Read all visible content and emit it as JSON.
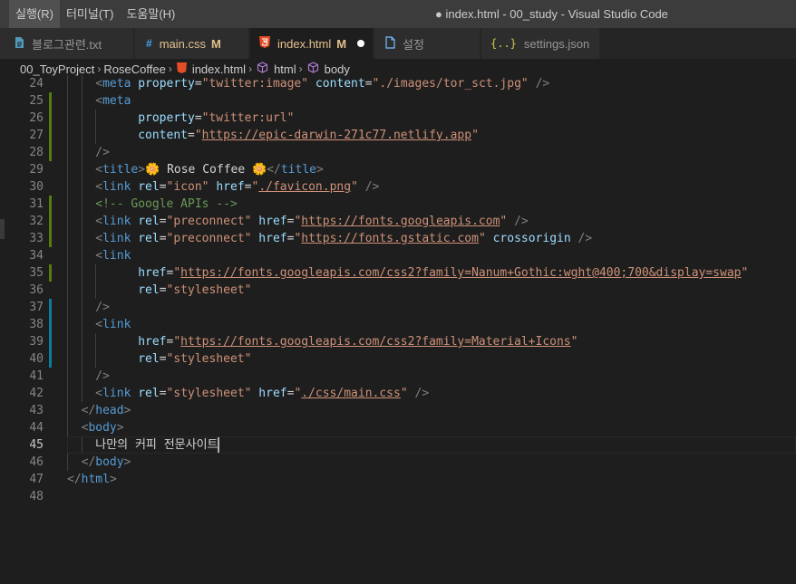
{
  "menu": [
    "실행(R)",
    "터미널(T)",
    "도움말(H)"
  ],
  "window_title": "● index.html - 00_study - Visual Studio Code",
  "tabs": [
    {
      "label": "블로그관련.txt",
      "icon": "file-icon",
      "modified": ""
    },
    {
      "label": "main.css",
      "icon": "css-icon",
      "modified": "M"
    },
    {
      "label": "index.html",
      "icon": "html5-icon",
      "modified": "M"
    },
    {
      "label": "설정",
      "icon": "file-icon",
      "modified": ""
    },
    {
      "label": "settings.json",
      "icon": "json-braces-icon",
      "modified": ""
    }
  ],
  "breadcrumb": [
    "00_ToyProject",
    "RoseCoffee",
    "index.html",
    "html",
    "body"
  ],
  "editor": {
    "current_line": "45",
    "lines": [
      {
        "n": "24",
        "tokens": [
          [
            "t-punc",
            "<"
          ],
          [
            "t-tag",
            "meta"
          ],
          [
            "t-txt",
            " "
          ],
          [
            "t-attr",
            "property"
          ],
          [
            "t-txt",
            "="
          ],
          [
            "t-str",
            "\"twitter:image\""
          ],
          [
            "t-txt",
            " "
          ],
          [
            "t-attr",
            "content"
          ],
          [
            "t-txt",
            "="
          ],
          [
            "t-str",
            "\"./images/tor_sct.jpg\""
          ],
          [
            "t-txt",
            " "
          ],
          [
            "t-punc",
            "/>"
          ]
        ]
      },
      {
        "n": "25",
        "tokens": [
          [
            "t-punc",
            "<"
          ],
          [
            "t-tag",
            "meta"
          ]
        ]
      },
      {
        "n": "26",
        "tokens": [
          [
            "t-txt",
            "  "
          ],
          [
            "t-attr",
            "property"
          ],
          [
            "t-txt",
            "="
          ],
          [
            "t-str",
            "\"twitter:url\""
          ]
        ]
      },
      {
        "n": "27",
        "tokens": [
          [
            "t-txt",
            "  "
          ],
          [
            "t-attr",
            "content"
          ],
          [
            "t-txt",
            "="
          ],
          [
            "t-str",
            "\""
          ],
          [
            "t-url",
            "https://epic-darwin-271c77.netlify.app"
          ],
          [
            "t-str",
            "\""
          ]
        ]
      },
      {
        "n": "28",
        "tokens": [
          [
            "t-punc",
            "/>"
          ]
        ]
      },
      {
        "n": "29",
        "tokens": [
          [
            "t-punc",
            "<"
          ],
          [
            "t-tag",
            "title"
          ],
          [
            "t-punc",
            ">"
          ],
          [
            "t-txt",
            "🌼 Rose Coffee 🌼"
          ],
          [
            "t-punc",
            "</"
          ],
          [
            "t-tag",
            "title"
          ],
          [
            "t-punc",
            ">"
          ]
        ]
      },
      {
        "n": "30",
        "tokens": [
          [
            "t-punc",
            "<"
          ],
          [
            "t-tag",
            "link"
          ],
          [
            "t-txt",
            " "
          ],
          [
            "t-attr",
            "rel"
          ],
          [
            "t-txt",
            "="
          ],
          [
            "t-str",
            "\"icon\""
          ],
          [
            "t-txt",
            " "
          ],
          [
            "t-attr",
            "href"
          ],
          [
            "t-txt",
            "="
          ],
          [
            "t-str",
            "\""
          ],
          [
            "t-url",
            "./favicon.png"
          ],
          [
            "t-str",
            "\""
          ],
          [
            "t-txt",
            " "
          ],
          [
            "t-punc",
            "/>"
          ]
        ]
      },
      {
        "n": "31",
        "tokens": [
          [
            "t-cmt",
            "<!-- Google APIs -->"
          ]
        ]
      },
      {
        "n": "32",
        "tokens": [
          [
            "t-punc",
            "<"
          ],
          [
            "t-tag",
            "link"
          ],
          [
            "t-txt",
            " "
          ],
          [
            "t-attr",
            "rel"
          ],
          [
            "t-txt",
            "="
          ],
          [
            "t-str",
            "\"preconnect\""
          ],
          [
            "t-txt",
            " "
          ],
          [
            "t-attr",
            "href"
          ],
          [
            "t-txt",
            "="
          ],
          [
            "t-str",
            "\""
          ],
          [
            "t-url",
            "https://fonts.googleapis.com"
          ],
          [
            "t-str",
            "\""
          ],
          [
            "t-txt",
            " "
          ],
          [
            "t-punc",
            "/>"
          ]
        ]
      },
      {
        "n": "33",
        "tokens": [
          [
            "t-punc",
            "<"
          ],
          [
            "t-tag",
            "link"
          ],
          [
            "t-txt",
            " "
          ],
          [
            "t-attr",
            "rel"
          ],
          [
            "t-txt",
            "="
          ],
          [
            "t-str",
            "\"preconnect\""
          ],
          [
            "t-txt",
            " "
          ],
          [
            "t-attr",
            "href"
          ],
          [
            "t-txt",
            "="
          ],
          [
            "t-str",
            "\""
          ],
          [
            "t-url",
            "https://fonts.gstatic.com"
          ],
          [
            "t-str",
            "\""
          ],
          [
            "t-txt",
            " "
          ],
          [
            "t-attr",
            "crossorigin"
          ],
          [
            "t-txt",
            " "
          ],
          [
            "t-punc",
            "/>"
          ]
        ]
      },
      {
        "n": "34",
        "tokens": [
          [
            "t-punc",
            "<"
          ],
          [
            "t-tag",
            "link"
          ]
        ]
      },
      {
        "n": "35",
        "tokens": [
          [
            "t-txt",
            "  "
          ],
          [
            "t-attr",
            "href"
          ],
          [
            "t-txt",
            "="
          ],
          [
            "t-str",
            "\""
          ],
          [
            "t-url",
            "https://fonts.googleapis.com/css2?family=Nanum+Gothic:wght@400;700&display=swap"
          ],
          [
            "t-str",
            "\""
          ]
        ]
      },
      {
        "n": "36",
        "tokens": [
          [
            "t-txt",
            "  "
          ],
          [
            "t-attr",
            "rel"
          ],
          [
            "t-txt",
            "="
          ],
          [
            "t-str",
            "\"stylesheet\""
          ]
        ]
      },
      {
        "n": "37",
        "tokens": [
          [
            "t-punc",
            "/>"
          ]
        ]
      },
      {
        "n": "38",
        "tokens": [
          [
            "t-punc",
            "<"
          ],
          [
            "t-tag",
            "link"
          ]
        ]
      },
      {
        "n": "39",
        "tokens": [
          [
            "t-txt",
            "  "
          ],
          [
            "t-attr",
            "href"
          ],
          [
            "t-txt",
            "="
          ],
          [
            "t-str",
            "\""
          ],
          [
            "t-url",
            "https://fonts.googleapis.com/css2?family=Material+Icons"
          ],
          [
            "t-str",
            "\""
          ]
        ]
      },
      {
        "n": "40",
        "tokens": [
          [
            "t-txt",
            "  "
          ],
          [
            "t-attr",
            "rel"
          ],
          [
            "t-txt",
            "="
          ],
          [
            "t-str",
            "\"stylesheet\""
          ]
        ]
      },
      {
        "n": "41",
        "tokens": [
          [
            "t-punc",
            "/>"
          ]
        ]
      },
      {
        "n": "42",
        "tokens": [
          [
            "t-punc",
            "<"
          ],
          [
            "t-tag",
            "link"
          ],
          [
            "t-txt",
            " "
          ],
          [
            "t-attr",
            "rel"
          ],
          [
            "t-txt",
            "="
          ],
          [
            "t-str",
            "\"stylesheet\""
          ],
          [
            "t-txt",
            " "
          ],
          [
            "t-attr",
            "href"
          ],
          [
            "t-txt",
            "="
          ],
          [
            "t-str",
            "\""
          ],
          [
            "t-url",
            "./css/main.css"
          ],
          [
            "t-str",
            "\""
          ],
          [
            "t-txt",
            " "
          ],
          [
            "t-punc",
            "/>"
          ]
        ]
      },
      {
        "n": "43",
        "tokens": [
          [
            "t-punc",
            "</"
          ],
          [
            "t-tag",
            "head"
          ],
          [
            "t-punc",
            ">"
          ]
        ]
      },
      {
        "n": "44",
        "tokens": [
          [
            "t-punc",
            "<"
          ],
          [
            "t-tag",
            "body"
          ],
          [
            "t-punc",
            ">"
          ]
        ]
      },
      {
        "n": "45",
        "tokens": [
          [
            "t-txt",
            "나만의 커피 전문사이트"
          ]
        ]
      },
      {
        "n": "46",
        "tokens": [
          [
            "t-punc",
            "</"
          ],
          [
            "t-tag",
            "body"
          ],
          [
            "t-punc",
            ">"
          ]
        ]
      },
      {
        "n": "47",
        "tokens": [
          [
            "t-punc",
            "</"
          ],
          [
            "t-tag",
            "html"
          ],
          [
            "t-punc",
            ">"
          ]
        ]
      },
      {
        "n": "48",
        "tokens": []
      }
    ]
  },
  "colors": {
    "titlebar": "#3c3c3c",
    "editor_bg": "#1e1e1e",
    "tag": "#569cd6",
    "attr": "#9cdcfe",
    "string": "#ce9178",
    "comment": "#6a9955",
    "modified": "#e2c08d",
    "git_modified_gutter": "#587c0c",
    "git_added_gutter": "#0c7d9d"
  }
}
